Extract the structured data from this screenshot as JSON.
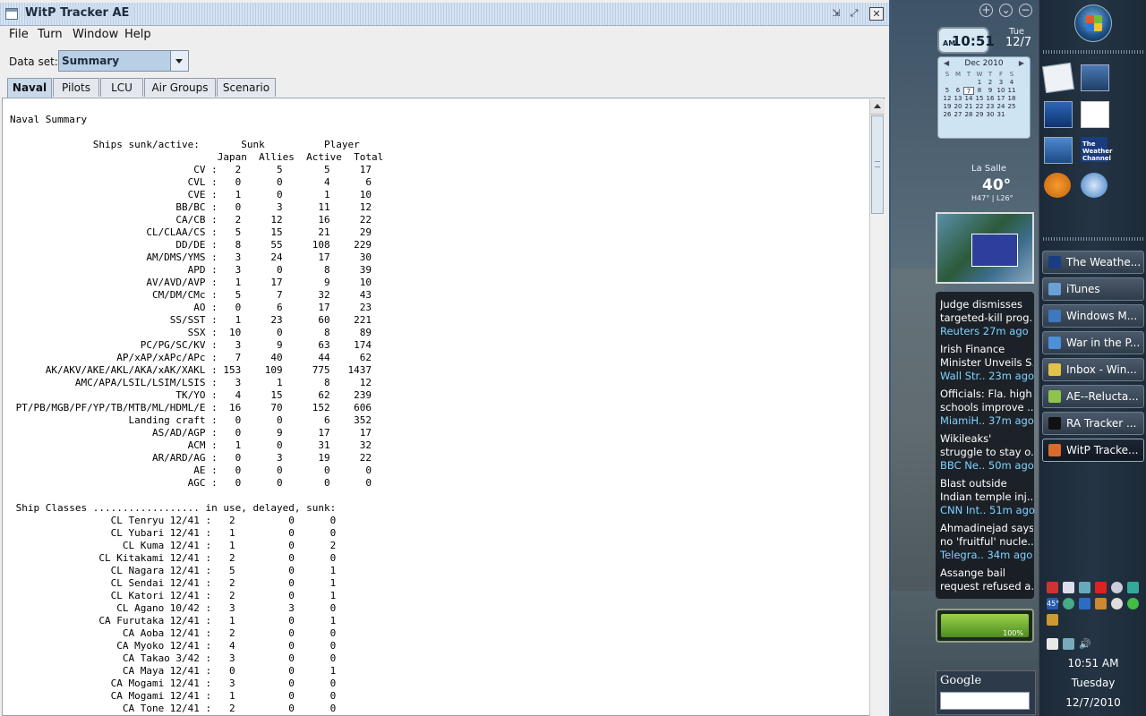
{
  "window": {
    "title": "WitP Tracker AE",
    "min_glyph": "⇲",
    "max_glyph": "⤢",
    "close_glyph": "✕"
  },
  "menu": [
    "File",
    "Turn",
    "Window",
    "Help"
  ],
  "dataset": {
    "label": "Data set:",
    "value": "Summary"
  },
  "tabs": [
    "Naval",
    "Pilots",
    "LCU",
    "Air Groups",
    "Scenario"
  ],
  "active_tab": "Naval",
  "report": {
    "title": "Naval Summary",
    "ships_header_left": "Ships sunk/active:",
    "ships_header_sunk": "Sunk",
    "ships_header_player": "Player",
    "columns": [
      "Japan",
      "Allies",
      "Active",
      "Total"
    ],
    "ship_rows": [
      [
        "CV",
        2,
        5,
        5,
        17
      ],
      [
        "CVL",
        0,
        0,
        4,
        6
      ],
      [
        "CVE",
        1,
        0,
        1,
        10
      ],
      [
        "BB/BC",
        0,
        3,
        11,
        12
      ],
      [
        "CA/CB",
        2,
        12,
        16,
        22
      ],
      [
        "CL/CLAA/CS",
        5,
        15,
        21,
        29
      ],
      [
        "DD/DE",
        8,
        55,
        108,
        229
      ],
      [
        "AM/DMS/YMS",
        3,
        24,
        17,
        30
      ],
      [
        "APD",
        3,
        0,
        8,
        39
      ],
      [
        "AV/AVD/AVP",
        1,
        17,
        9,
        10
      ],
      [
        "CM/DM/CMc",
        5,
        7,
        32,
        43
      ],
      [
        "AO",
        0,
        6,
        17,
        23
      ],
      [
        "SS/SST",
        1,
        23,
        60,
        221
      ],
      [
        "SSX",
        10,
        0,
        8,
        89
      ],
      [
        "PC/PG/SC/KV",
        3,
        9,
        63,
        174
      ],
      [
        "AP/xAP/xAPc/APc",
        7,
        40,
        44,
        62
      ],
      [
        "AK/AKV/AKE/AKL/AKA/xAK/XAKL",
        153,
        109,
        775,
        1437
      ],
      [
        "AMC/APA/LSIL/LSIM/LSIS",
        3,
        1,
        8,
        12
      ],
      [
        "TK/YO",
        4,
        15,
        62,
        239
      ],
      [
        "PT/PB/MGB/PF/YP/TB/MTB/ML/HDML/E",
        16,
        70,
        152,
        606
      ],
      [
        "Landing craft",
        0,
        0,
        6,
        352
      ],
      [
        "AS/AD/AGP",
        0,
        9,
        17,
        17
      ],
      [
        "ACM",
        1,
        0,
        31,
        32
      ],
      [
        "AR/ARD/AG",
        0,
        3,
        19,
        22
      ],
      [
        "AE",
        0,
        0,
        0,
        0
      ],
      [
        "AGC",
        0,
        0,
        0,
        0
      ]
    ],
    "classes_header": "Ship Classes .................. in use, delayed, sunk:",
    "class_rows": [
      [
        "CL Tenryu 12/41",
        2,
        0,
        0
      ],
      [
        "CL Yubari 12/41",
        1,
        0,
        0
      ],
      [
        "CL Kuma 12/41",
        1,
        0,
        2
      ],
      [
        "CL Kitakami 12/41",
        2,
        0,
        0
      ],
      [
        "CL Nagara 12/41",
        5,
        0,
        1
      ],
      [
        "CL Sendai 12/41",
        2,
        0,
        1
      ],
      [
        "CL Katori 12/41",
        2,
        0,
        1
      ],
      [
        "CL Agano 10/42",
        3,
        3,
        0
      ],
      [
        "CA Furutaka 12/41",
        1,
        0,
        1
      ],
      [
        "CA Aoba 12/41",
        2,
        0,
        0
      ],
      [
        "CA Myoko 12/41",
        4,
        0,
        0
      ],
      [
        "CA Takao 3/42",
        3,
        0,
        0
      ],
      [
        "CA Maya 12/41",
        0,
        0,
        1
      ],
      [
        "CA Mogami 12/41",
        3,
        0,
        0
      ],
      [
        "CA Mogami 12/41",
        1,
        0,
        0
      ],
      [
        "CA Tone 12/41",
        2,
        0,
        0
      ]
    ]
  },
  "sidebar": {
    "controls": [
      "+",
      "⌄",
      "−"
    ],
    "clock": {
      "ampm": "AM",
      "time": "10:51",
      "day": "Tue",
      "date": "12/7"
    },
    "calendar": {
      "month": "Dec 2010",
      "weekdays": [
        "S",
        "M",
        "T",
        "W",
        "T",
        "F",
        "S"
      ],
      "weeks": [
        [
          "",
          "",
          "",
          "1",
          "2",
          "3",
          "4"
        ],
        [
          "5",
          "6",
          "7",
          "8",
          "9",
          "10",
          "11"
        ],
        [
          "12",
          "13",
          "14",
          "15",
          "16",
          "17",
          "18"
        ],
        [
          "19",
          "20",
          "21",
          "22",
          "23",
          "24",
          "25"
        ],
        [
          "26",
          "27",
          "28",
          "29",
          "30",
          "31",
          ""
        ]
      ],
      "today": "7"
    },
    "weather": {
      "city": "La Salle",
      "temp": "40°",
      "hilo": "H47° | L26°"
    },
    "news": [
      {
        "headline": [
          "Judge dismisses",
          "targeted-kill prog.."
        ],
        "source": "Reuters",
        "age": "27m ago"
      },
      {
        "headline": [
          "Irish Finance",
          "Minister Unveils S.."
        ],
        "source": "Wall Str..",
        "age": "23m ago"
      },
      {
        "headline": [
          "Officials: Fla. high",
          "schools improve .."
        ],
        "source": "MiamiH..",
        "age": "37m ago"
      },
      {
        "headline": [
          "Wikileaks'",
          "struggle to stay o.."
        ],
        "source": "BBC Ne..",
        "age": "50m ago"
      },
      {
        "headline": [
          "Blast outside",
          "Indian temple inj.."
        ],
        "source": "CNN Int..",
        "age": "51m ago"
      },
      {
        "headline": [
          "Ahmadinejad says",
          "no 'fruitful' nucle.."
        ],
        "source": "Telegra..",
        "age": "34m ago"
      },
      {
        "headline": [
          "Assange bail",
          "request refused a.."
        ],
        "source": "",
        "age": ""
      }
    ],
    "battery": {
      "percent": "100%",
      "level": 100
    },
    "search": {
      "logo": "Google",
      "placeholder": ""
    }
  },
  "taskbar": {
    "quick_launch": {
      "weather_channel": "The Weather Channel"
    },
    "items": [
      {
        "label": "The Weathe...",
        "icon_color": "#1a3c80",
        "active": false
      },
      {
        "label": "iTunes",
        "icon_color": "#6aa0d8",
        "active": false
      },
      {
        "label": "Windows M...",
        "icon_color": "#3d78c2",
        "active": false
      },
      {
        "label": "War in the P...",
        "icon_color": "#4d8fd8",
        "active": false
      },
      {
        "label": "Inbox - Win...",
        "icon_color": "#e3c24a",
        "active": false
      },
      {
        "label": "AE--Relucta...",
        "icon_color": "#8fc34a",
        "active": false
      },
      {
        "label": "RA Tracker ...",
        "icon_color": "#111111",
        "active": false
      },
      {
        "label": "WitP Tracke...",
        "icon_color": "#d96a2a",
        "active": true
      }
    ],
    "tray_temp": "45°",
    "clock": {
      "time": "10:51 AM",
      "day": "Tuesday",
      "date": "12/7/2010"
    }
  }
}
